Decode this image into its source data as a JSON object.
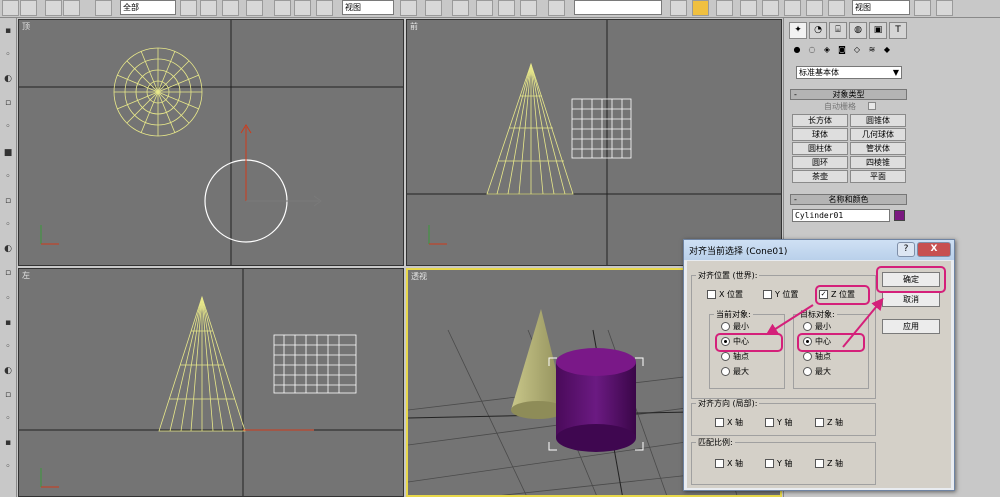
{
  "toolbar": {
    "selection_filter": "全部",
    "ref_coord": "视图",
    "view_dropdown_right": "视图"
  },
  "viewports": {
    "top": {
      "label": "顶"
    },
    "front": {
      "label": "前"
    },
    "left": {
      "label": "左"
    },
    "perspective": {
      "label": "透视"
    }
  },
  "command_panel": {
    "category_dropdown": "标准基本体",
    "object_type": {
      "title": "对象类型",
      "autogrid_label": "自动栅格",
      "buttons": [
        "长方体",
        "圆锥体",
        "球体",
        "几何球体",
        "圆柱体",
        "管状体",
        "圆环",
        "四棱锥",
        "茶壶",
        "平面"
      ]
    },
    "name_color": {
      "title": "名称和颜色",
      "object_name": "Cylinder01",
      "color": "#7a1880"
    }
  },
  "dialog": {
    "title": "对齐当前选择 (Cone01)",
    "help_btn": "?",
    "close_btn": "X",
    "position_group": {
      "legend": "对齐位置 (世界):",
      "x_label": "X 位置",
      "y_label": "Y 位置",
      "z_label": "Z 位置",
      "x_checked": false,
      "y_checked": false,
      "z_checked": true
    },
    "current_object": {
      "legend": "当前对象:",
      "options": [
        "最小",
        "中心",
        "轴点",
        "最大"
      ],
      "selected": "中心"
    },
    "target_object": {
      "legend": "目标对象:",
      "options": [
        "最小",
        "中心",
        "轴点",
        "最大"
      ],
      "selected": "中心"
    },
    "orientation_group": {
      "legend": "对齐方向 (局部):",
      "x_label": "X 轴",
      "y_label": "Y 轴",
      "z_label": "Z 轴"
    },
    "scale_group": {
      "legend": "匹配比例:",
      "x_label": "X 轴",
      "y_label": "Y 轴",
      "z_label": "Z 轴"
    },
    "buttons": {
      "ok": "确定",
      "cancel": "取消",
      "apply": "应用"
    }
  },
  "colors": {
    "highlight": "#d4207a",
    "cone_wire": "#e8e88a",
    "cylinder": "#5a0e6e",
    "viewport_bg": "#747474",
    "active_viewport_border": "#e8d84a"
  }
}
